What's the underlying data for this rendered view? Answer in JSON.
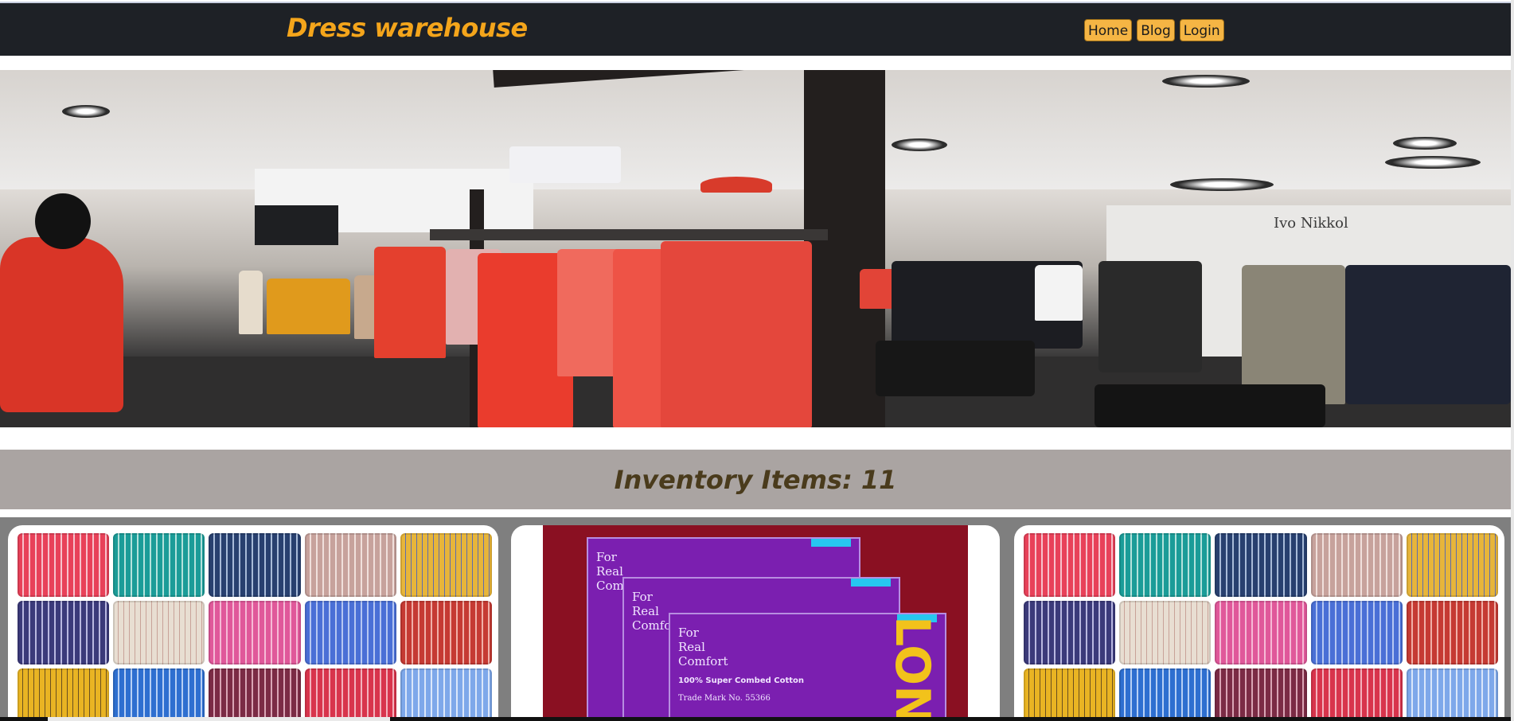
{
  "header": {
    "brand": "Dress warehouse",
    "nav": [
      {
        "label": "Home"
      },
      {
        "label": "Blog"
      },
      {
        "label": "Login"
      }
    ]
  },
  "hero": {
    "store_sign": "Ivo Nikkol"
  },
  "inventory": {
    "title": "Inventory Items: 11"
  },
  "products": {
    "box": {
      "line1": "For",
      "line2": "Real",
      "line3": "Comfort",
      "subtitle": "100% Super Combed Cotton",
      "trademark": "Trade Mark No. 55366",
      "brand_letters": "LON"
    }
  },
  "colors": {
    "topbar": "#1e2126",
    "brand": "#f4a51b",
    "nav_button": "#f5b544",
    "inventory_bar": "#aaa4a2",
    "inventory_text": "#4a3b1c",
    "grid_background": "#7f7f7f"
  }
}
